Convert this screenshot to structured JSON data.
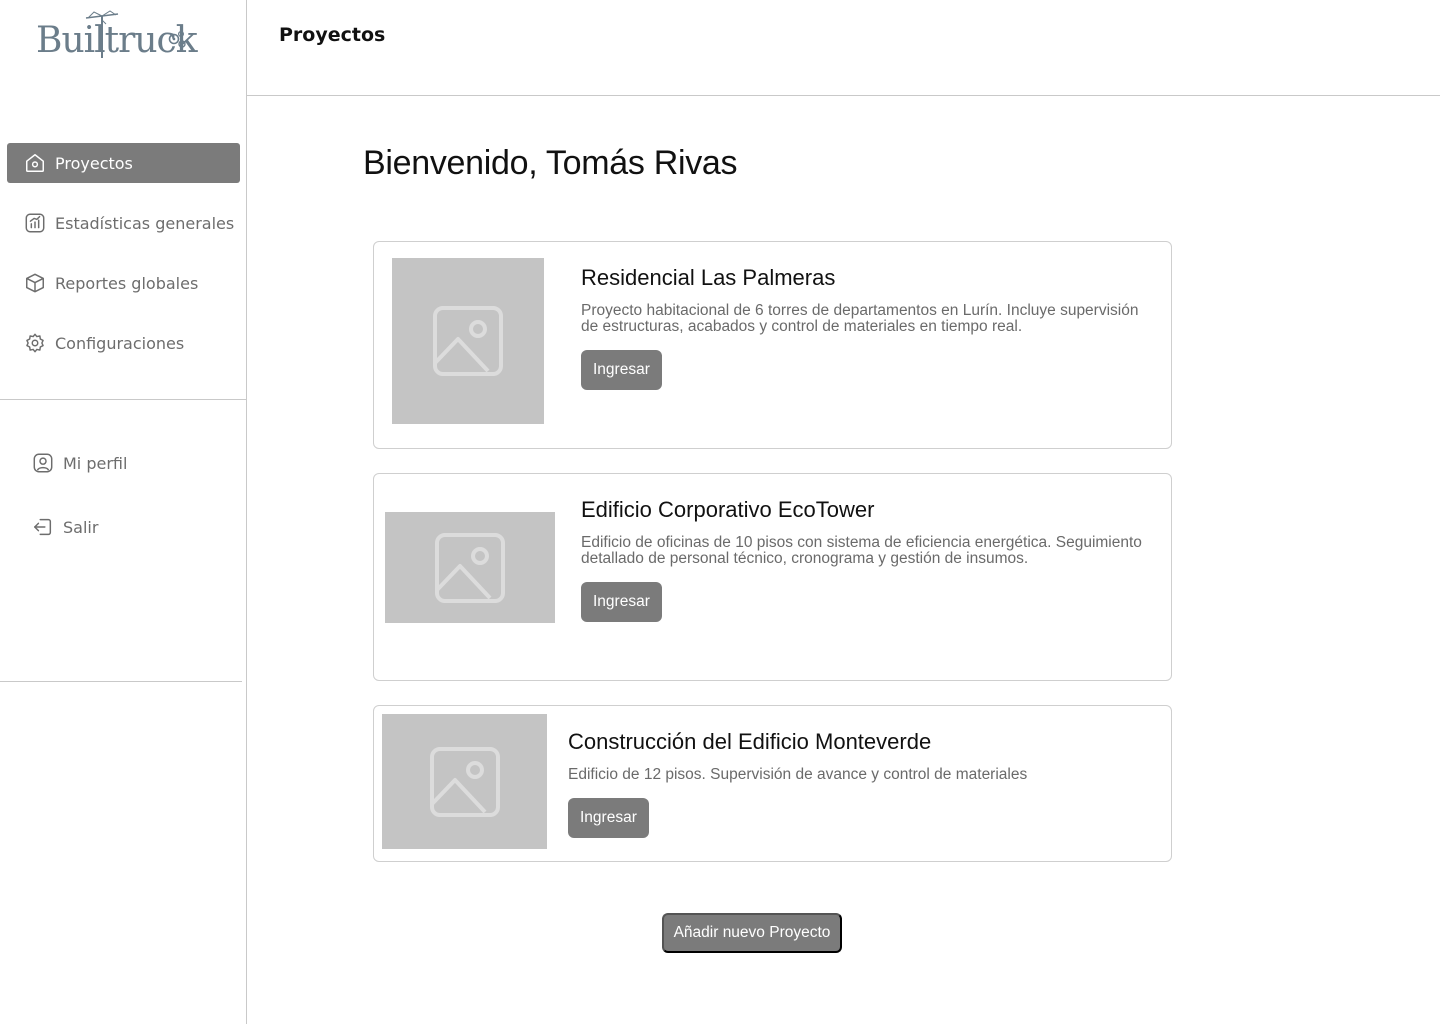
{
  "app": {
    "logo_text": "Builtruck"
  },
  "sidebar": {
    "items": [
      {
        "label": "Proyectos",
        "icon": "home-icon",
        "active": true
      },
      {
        "label": "Estadísticas generales",
        "icon": "chart-icon",
        "active": false
      },
      {
        "label": "Reportes globales",
        "icon": "box-icon",
        "active": false
      },
      {
        "label": "Configuraciones",
        "icon": "gear-icon",
        "active": false
      }
    ],
    "account": [
      {
        "label": "Mi perfil",
        "icon": "user-icon"
      },
      {
        "label": "Salir",
        "icon": "logout-icon"
      }
    ]
  },
  "header": {
    "title": "Proyectos"
  },
  "main": {
    "welcome": "Bienvenido, Tomás Rivas",
    "projects": [
      {
        "title": "Residencial Las Palmeras",
        "description": "Proyecto habitacional de 6 torres de departamentos en Lurín. Incluye supervisión de estructuras, acabados y control de materiales en tiempo real.",
        "button": "Ingresar",
        "image_icon": "image-placeholder-icon"
      },
      {
        "title": "Edificio Corporativo EcoTower",
        "description": "Edificio de oficinas de 10 pisos con sistema de eficiencia energética. Seguimiento detallado de personal técnico, cronograma y gestión de insumos.",
        "button": "Ingresar",
        "image_icon": "image-placeholder-icon"
      },
      {
        "title": "Construcción del Edificio Monteverde",
        "description": "Edificio de 12 pisos. Supervisión de avance y control de materiales",
        "button": "Ingresar",
        "image_icon": "image-placeholder-icon"
      }
    ],
    "add_button": "Añadir nuevo Proyecto"
  },
  "colors": {
    "accent": "#7b7b7b",
    "placeholder": "#c4c4c4",
    "border": "#c9c9c9",
    "logo": "#6b7d8a"
  }
}
